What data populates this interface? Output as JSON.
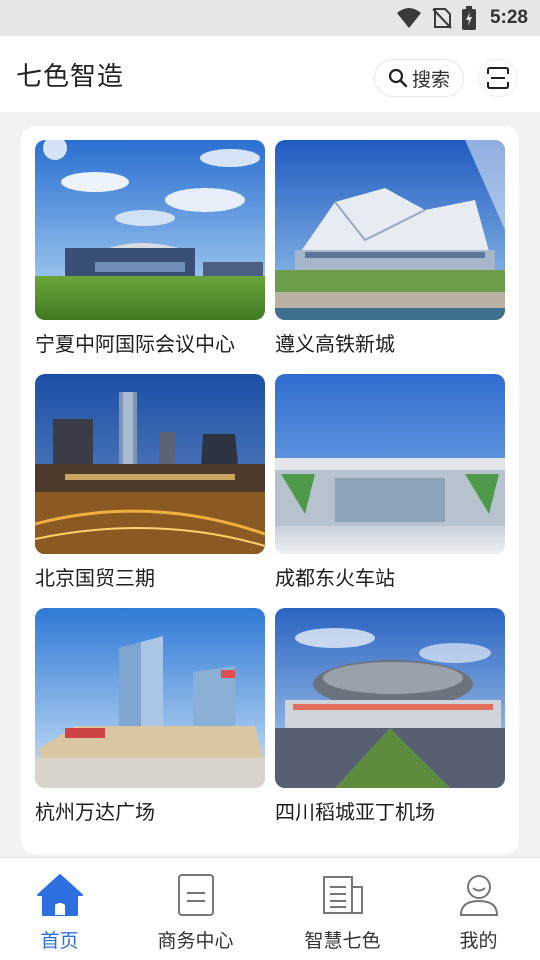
{
  "status_bar": {
    "time": "5:28"
  },
  "header": {
    "title": "七色智造",
    "search_label": "搜索"
  },
  "projects": [
    {
      "name": "宁夏中阿国际会议中心"
    },
    {
      "name": "遵义高铁新城"
    },
    {
      "name": "北京国贸三期"
    },
    {
      "name": "成都东火车站"
    },
    {
      "name": "杭州万达广场"
    },
    {
      "name": "四川稻城亚丁机场"
    }
  ],
  "bottom_nav": [
    {
      "label": "首页",
      "icon": "home-icon",
      "active": true
    },
    {
      "label": "商务中心",
      "icon": "document-icon"
    },
    {
      "label": "智慧七色",
      "icon": "newspaper-icon"
    },
    {
      "label": "我的",
      "icon": "user-icon"
    }
  ],
  "colors": {
    "accent": "#2d6fe0",
    "background": "#f2f2f2",
    "header": "#ffffff"
  }
}
